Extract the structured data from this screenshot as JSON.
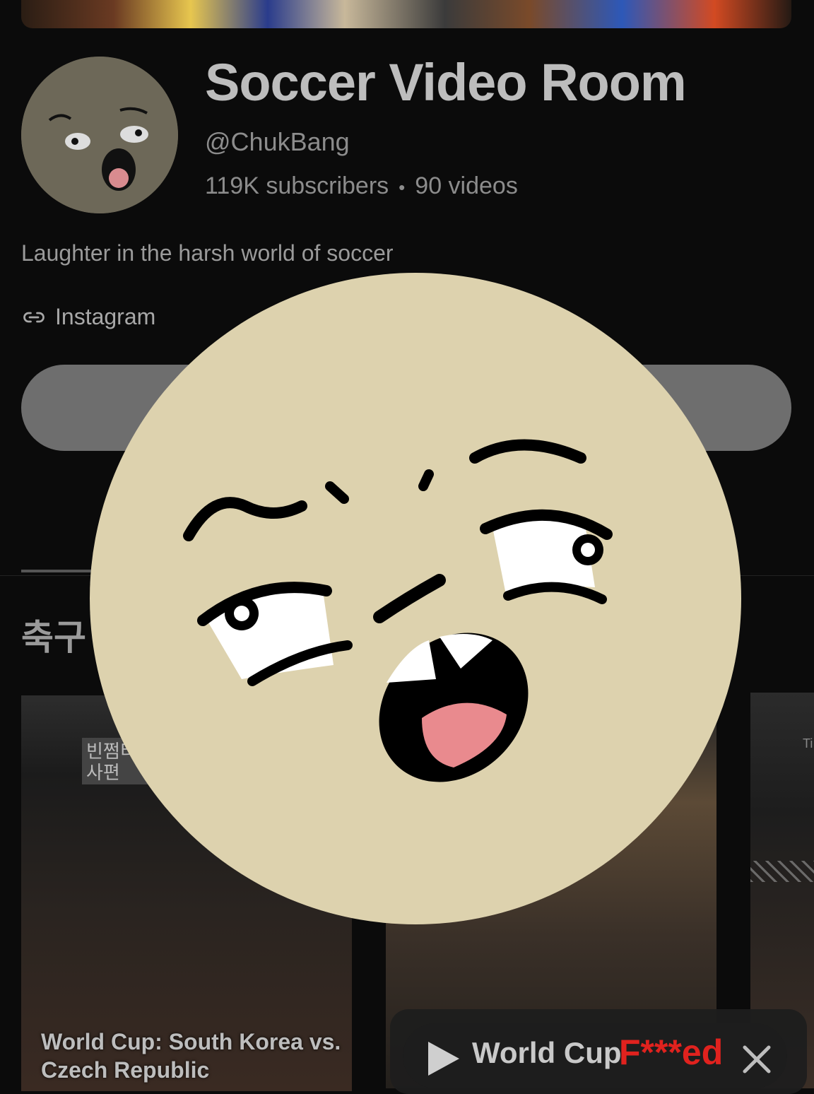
{
  "channel": {
    "title": "Soccer Video Room",
    "handle": "@ChukBang",
    "subscribers": "119K subscribers",
    "separator": "•",
    "videos": "90 videos",
    "description": "Laughter in the harsh world of soccer",
    "link_label": "Instagram"
  },
  "section": {
    "heading": "축구"
  },
  "thumbnails": [
    {
      "badge_line1": "빈쩜티",
      "badge_line2": "사편",
      "caption_line1": "World Cup: South Korea vs.",
      "caption_line2": "Czech Republic"
    },
    {
      "caption_line1": "",
      "caption_line2": ""
    },
    {
      "label": "Ti"
    }
  ],
  "overlay_pill": {
    "text": "World Cup",
    "red_text": "F***ed"
  },
  "colors": {
    "avatar_bg": "#ddd2ae",
    "accent_red": "#e0221e",
    "background": "#0b0b0b"
  }
}
